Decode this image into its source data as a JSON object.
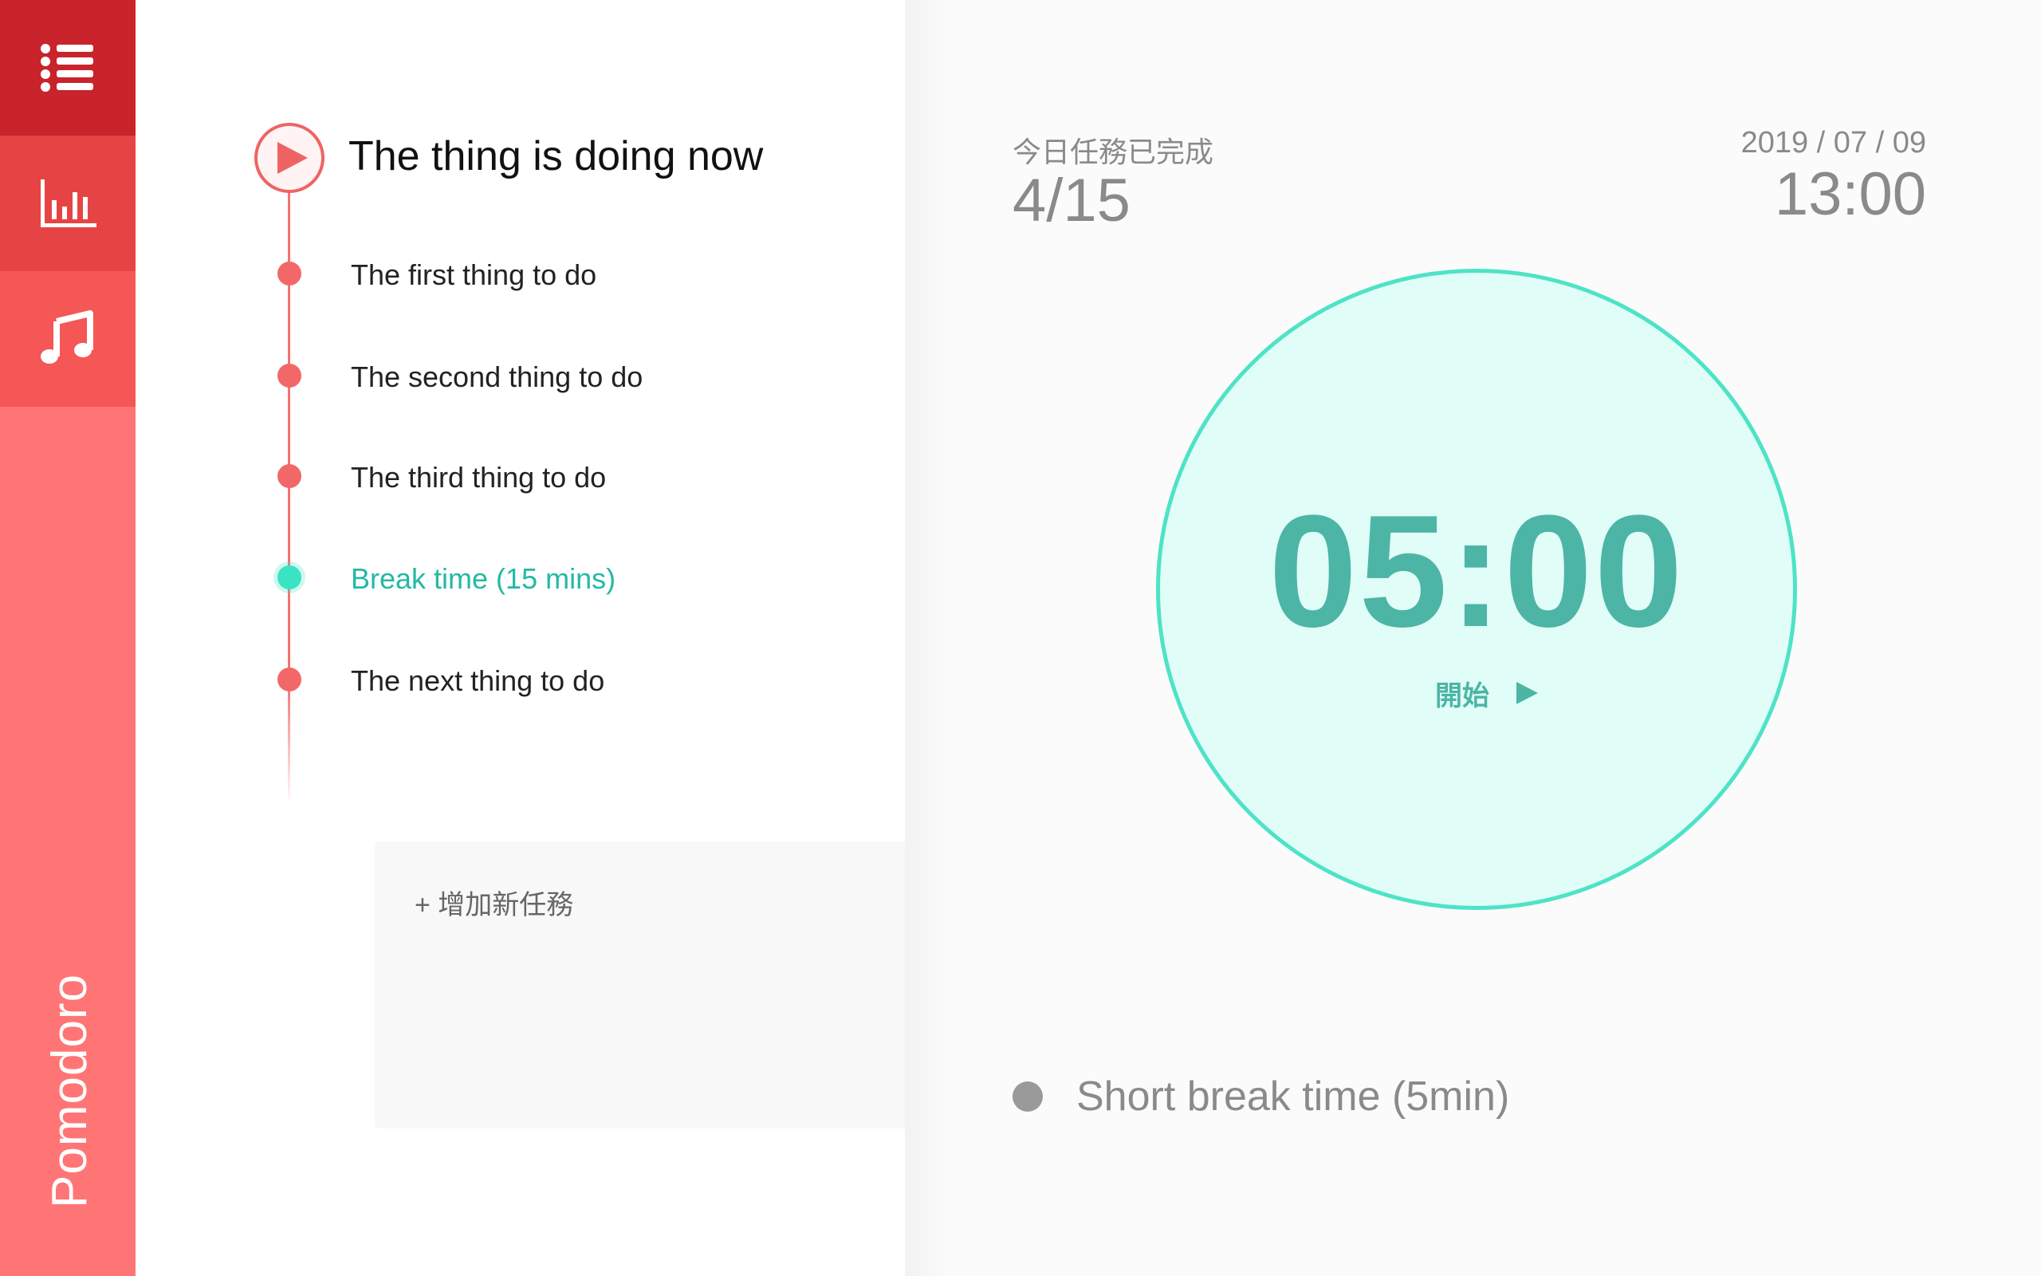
{
  "sidebar": {
    "brand": "Pomodoro",
    "buttons": [
      {
        "name": "list-icon",
        "color": "#c9232b"
      },
      {
        "name": "chart-icon",
        "color": "#e64444"
      },
      {
        "name": "music-icon",
        "color": "#f55656"
      }
    ],
    "background": "#ff7575"
  },
  "tasks": {
    "current_title": "The thing is doing now",
    "items": [
      {
        "label": "The first thing to do",
        "type": "task"
      },
      {
        "label": "The second thing to do",
        "type": "task"
      },
      {
        "label": "The third thing to do",
        "type": "task"
      },
      {
        "label": "Break time (15 mins)",
        "type": "break"
      },
      {
        "label": "The next thing to do",
        "type": "task"
      }
    ],
    "add_label": "+  增加新任務"
  },
  "stats": {
    "completed_label": "今日任務已完成",
    "completed_count": "4/15"
  },
  "clock": {
    "date": "2019 / 07 / 09",
    "time": "13:00"
  },
  "timer": {
    "value": "05:00",
    "start_label": "開始"
  },
  "status": {
    "label": "Short break time (5min)"
  },
  "colors": {
    "accent": "#ee6464",
    "break": "#3ae3c4",
    "timer_text": "#4db5a5",
    "timer_bg": "#e0fdf8"
  }
}
